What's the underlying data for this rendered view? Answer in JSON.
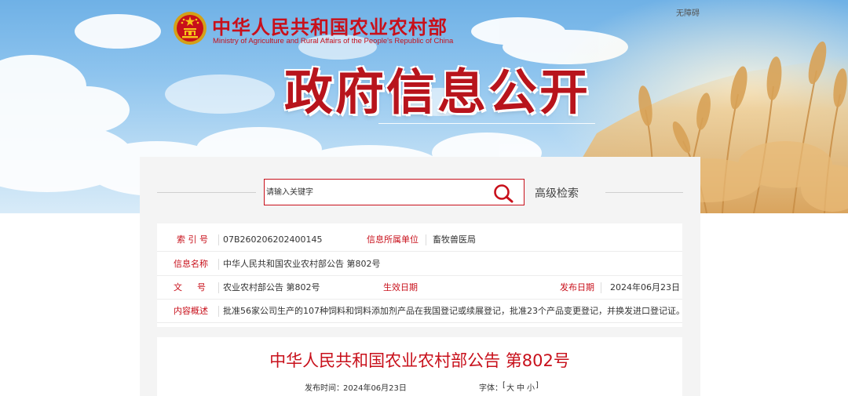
{
  "header": {
    "ministry_cn": "中华人民共和国农业农村部",
    "ministry_en": "Ministry of Agriculture and Rural Affairs of the People's Republic of China",
    "accessibility": "无障碍",
    "section_title": "政府信息公开",
    "brand_color": "#c8101b"
  },
  "search": {
    "placeholder": "请输入关键字",
    "button_icon": "search-icon",
    "advanced_label": "高级检索"
  },
  "info": {
    "index_label": "索 引 号",
    "index_value": "07B260206202400145",
    "unit_label": "信息所属单位",
    "unit_value": "畜牧兽医局",
    "name_label": "信息名称",
    "name_value": "中华人民共和国农业农村部公告 第802号",
    "doc_label_1": "文",
    "doc_label_2": "号",
    "doc_value": "农业农村部公告 第802号",
    "effective_label": "生效日期",
    "effective_value": "",
    "publish_label": "发布日期",
    "publish_value": "2024年06月23日",
    "summary_label": "内容概述",
    "summary_value": "批准56家公司生产的107种饲料和饲料添加剂产品在我国登记或续展登记，批准23个产品变更登记，并换发进口登记证。"
  },
  "article": {
    "title": "中华人民共和国农业农村部公告 第802号",
    "publish_label": "发布时间：",
    "publish_value": "2024年06月23日",
    "font_label": "字体：",
    "font_open": "[",
    "font_large": "大",
    "font_medium": "中",
    "font_small": "小",
    "font_close": "]"
  }
}
